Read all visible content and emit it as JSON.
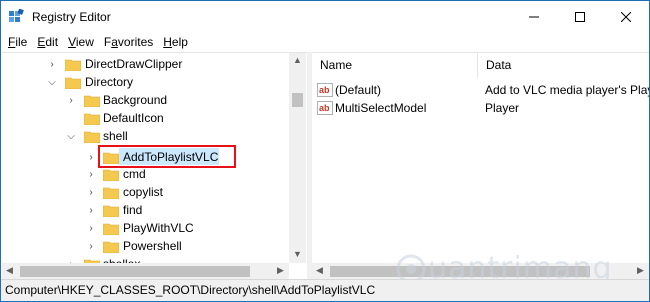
{
  "window": {
    "title": "Registry Editor"
  },
  "menu": [
    {
      "label": "File",
      "key": "F",
      "rest": "ile"
    },
    {
      "label": "Edit",
      "key": "E",
      "rest": "dit"
    },
    {
      "label": "View",
      "key": "V",
      "rest": "iew"
    },
    {
      "label": "Favorites",
      "key": "",
      "pre": "F",
      "keyMid": "a",
      "rest": "vorites"
    },
    {
      "label": "Help",
      "key": "H",
      "rest": "elp"
    }
  ],
  "tree": {
    "items": [
      {
        "label": "DirectDrawClipper",
        "expanded": false
      },
      {
        "label": "Directory",
        "expanded": true
      },
      {
        "label": "Background",
        "expanded": false
      },
      {
        "label": "DefaultIcon",
        "expanded": false
      },
      {
        "label": "shell",
        "expanded": true
      },
      {
        "label": "AddToPlaylistVLC",
        "expanded": false,
        "selected": true
      },
      {
        "label": "cmd",
        "expanded": false
      },
      {
        "label": "copylist",
        "expanded": false
      },
      {
        "label": "find",
        "expanded": false
      },
      {
        "label": "PlayWithVLC",
        "expanded": false
      },
      {
        "label": "Powershell",
        "expanded": false
      },
      {
        "label": "shellex",
        "expanded": false
      }
    ]
  },
  "list": {
    "columns": [
      "Name",
      "Data"
    ],
    "rows": [
      {
        "name": "(Default)",
        "data": "Add to VLC media player's Playlist"
      },
      {
        "name": "MultiSelectModel",
        "data": "Player"
      }
    ]
  },
  "status": {
    "path": "Computer\\HKEY_CLASSES_ROOT\\Directory\\shell\\AddToPlaylistVLC"
  },
  "watermark": {
    "text": "uantrimang"
  },
  "colors": {
    "selection_outline": "#e8111a",
    "selection_bg": "#cce8ff",
    "folder": "#f5c94f"
  }
}
